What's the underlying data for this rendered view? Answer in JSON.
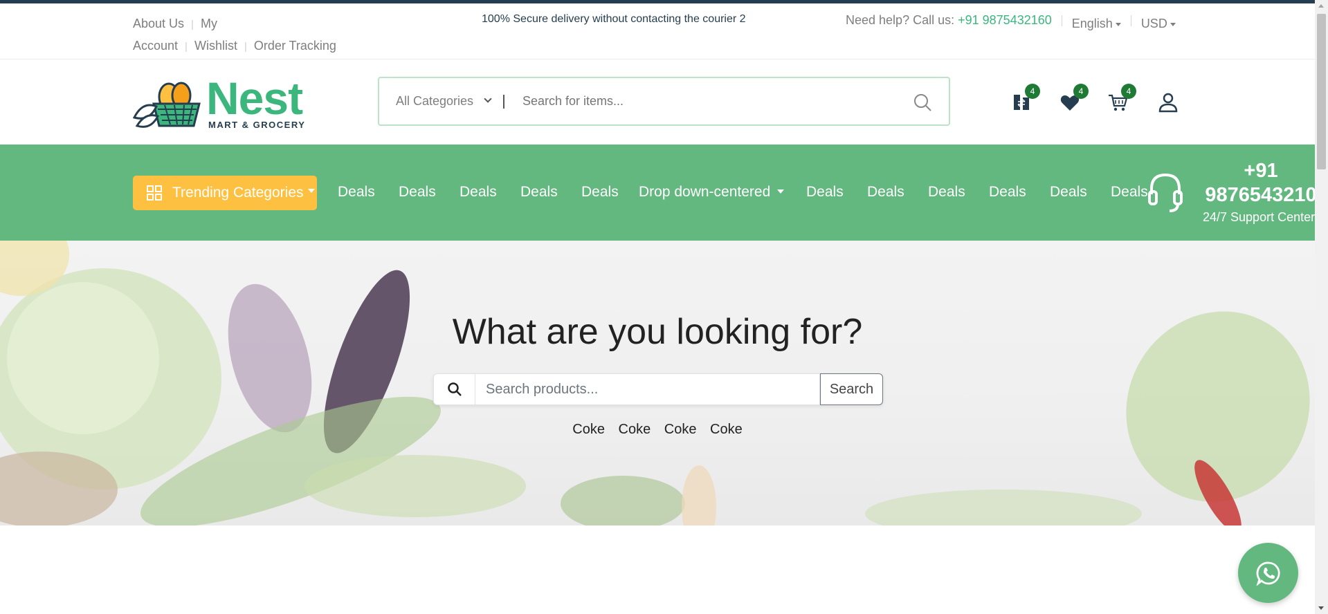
{
  "top_bar": {
    "links": [
      "About Us",
      "My Account",
      "Wishlist",
      "Order Tracking"
    ],
    "promo": "100% Secure delivery without contacting the courier 2",
    "help_text": "Need help? Call us:",
    "help_phone": "+91 9875432160",
    "language": "English",
    "currency": "USD"
  },
  "logo": {
    "brand": "Nest",
    "tagline": "MART & GROCERY"
  },
  "search": {
    "category": "All Categories",
    "placeholder": "Search for items..."
  },
  "header_icons": {
    "compare_count": "4",
    "wishlist_count": "4",
    "cart_count": "4"
  },
  "nav": {
    "trending_label": "Trending Categories",
    "items": [
      "Deals",
      "Deals",
      "Deals",
      "Deals",
      "Deals",
      "Drop down-centered",
      "Deals",
      "Deals",
      "Deals",
      "Deals",
      "Deals",
      "Deals"
    ],
    "support_phone_line1": "+91",
    "support_phone_line2": "9876543210",
    "support_label": "24/7 Support Center"
  },
  "hero": {
    "title": "What are you looking for?",
    "search_placeholder": "Search products...",
    "search_button": "Search",
    "tags": [
      "Coke",
      "Coke",
      "Coke",
      "Coke"
    ]
  },
  "colors": {
    "brand_green": "#3bb77e",
    "nav_green": "#63b87f",
    "accent_yellow": "#fdc040",
    "badge_green": "#1e7a34",
    "dark_text": "#253d4e"
  }
}
